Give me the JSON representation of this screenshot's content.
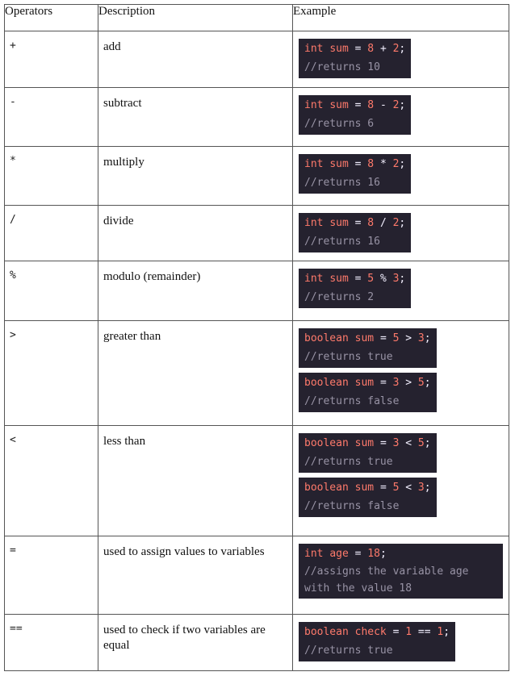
{
  "headers": {
    "operators": "Operators",
    "description": "Description",
    "example": "Example"
  },
  "rows": [
    {
      "op": "+",
      "desc": "add",
      "examples": [
        {
          "type": "int",
          "name": "sum",
          "a": "8",
          "op": "+",
          "b": "2",
          "comment": "//returns 10"
        }
      ]
    },
    {
      "op": "-",
      "desc": "subtract",
      "examples": [
        {
          "type": "int",
          "name": "sum",
          "a": "8",
          "op": "-",
          "b": "2",
          "comment": "//returns 6"
        }
      ]
    },
    {
      "op": "*",
      "desc": "multiply",
      "examples": [
        {
          "type": "int",
          "name": "sum",
          "a": "8",
          "op": "*",
          "b": "2",
          "comment": "//returns 16"
        }
      ]
    },
    {
      "op": "/",
      "desc": "divide",
      "examples": [
        {
          "type": "int",
          "name": "sum",
          "a": "8",
          "op": "/",
          "b": "2",
          "comment": "//returns 16"
        }
      ]
    },
    {
      "op": "%",
      "desc": "modulo (remainder)",
      "examples": [
        {
          "type": "int",
          "name": "sum",
          "a": "5",
          "op": "%",
          "b": "3",
          "comment": "//returns 2"
        }
      ]
    },
    {
      "op": ">",
      "desc": "greater than",
      "examples": [
        {
          "type": "boolean",
          "name": "sum",
          "a": "5",
          "op": ">",
          "b": "3",
          "comment": "//returns true"
        },
        {
          "type": "boolean",
          "name": "sum",
          "a": "3",
          "op": ">",
          "b": "5",
          "comment": "//returns false"
        }
      ]
    },
    {
      "op": "<",
      "desc": "less than",
      "examples": [
        {
          "type": "boolean",
          "name": "sum",
          "a": "3",
          "op": "<",
          "b": "5",
          "comment": "//returns true"
        },
        {
          "type": "boolean",
          "name": "sum",
          "a": "5",
          "op": "<",
          "b": "3",
          "comment": "//returns false"
        }
      ]
    },
    {
      "op": "=",
      "desc": "used to assign values to variables",
      "assign": {
        "type": "int",
        "name": "age",
        "eq": "=",
        "value": "18",
        "comment": "//assigns the variable age with the value 18"
      }
    },
    {
      "op": "==",
      "desc": "used to check if two variables are equal",
      "examples": [
        {
          "type": "boolean",
          "name": "check",
          "eq": "=",
          "a": "1",
          "op": "==",
          "b": "1",
          "comment": "//returns true"
        }
      ]
    }
  ],
  "colors": {
    "code_bg": "#25222f",
    "keyword": "#ff7a6b",
    "comment": "#9893a5"
  }
}
